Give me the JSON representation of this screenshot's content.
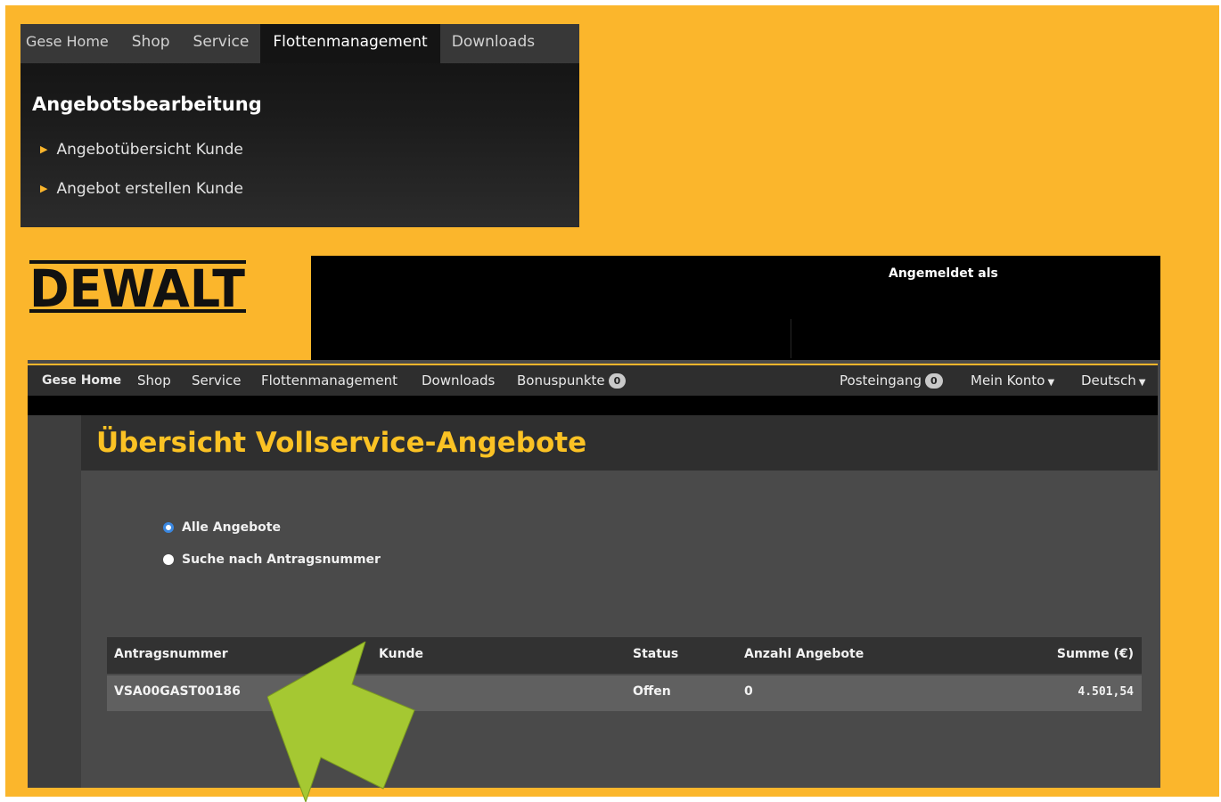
{
  "dropdown_card": {
    "nav": [
      "Gese Home",
      "Shop",
      "Service",
      "Flottenmanagement",
      "Downloads"
    ],
    "active_nav": "Flottenmanagement",
    "title": "Angebotsbearbeitung",
    "links": [
      "Angebotübersicht Kunde",
      "Angebot erstellen Kunde"
    ]
  },
  "logo": {
    "text": "DEWALT"
  },
  "header": {
    "logged_in_label": "Angemeldet als"
  },
  "app_nav": {
    "home": "Gese Home",
    "shop": "Shop",
    "service": "Service",
    "fleet": "Flottenmanagement",
    "downloads": "Downloads",
    "bonus": "Bonuspunkte",
    "bonus_count": "0",
    "inbox": "Posteingang",
    "inbox_count": "0",
    "account": "Mein Konto",
    "language": "Deutsch"
  },
  "page": {
    "title": "Übersicht Vollservice-Angebote",
    "radio_all": "Alle Angebote",
    "radio_search": "Suche nach Antragsnummer",
    "selected_radio": "Alle Angebote"
  },
  "table": {
    "headers": [
      "Antragsnummer",
      "Kunde",
      "Status",
      "Anzahl Angebote",
      "Summe (€)"
    ],
    "rows": [
      [
        "VSA00GAST00186",
        "",
        "Offen",
        "0",
        "4.501,54"
      ]
    ]
  },
  "colors": {
    "background": "#fbb62c",
    "title_yellow": "#fbc224",
    "arrow_green": "#a5c832",
    "radio_blue": "#3a87e0"
  }
}
